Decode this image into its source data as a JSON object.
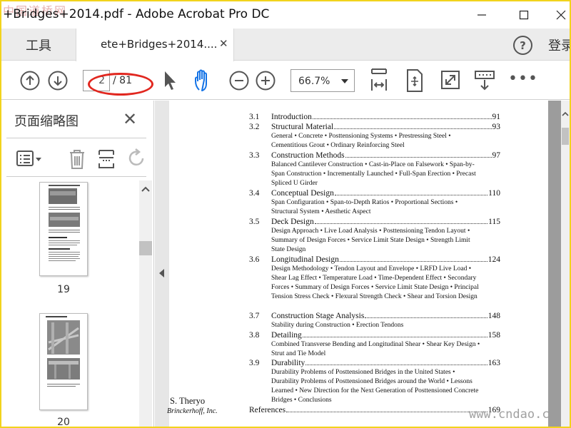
{
  "app": {
    "window_title": "+Bridges+2014.pdf - Adobe Acrobat Pro DC",
    "watermark_top": "中国道桥网",
    "watermark_bottom": "www.cndao.c"
  },
  "tabs": {
    "tools_label": "工具",
    "doc_label": "ete+Bridges+2014....",
    "signin_label": "登录"
  },
  "toolbar": {
    "current_page": "2",
    "total_pages": "/ 81",
    "zoom": "66.7%"
  },
  "sidebar": {
    "title": "页面缩略图",
    "thumbnails": [
      {
        "page_label": "19"
      },
      {
        "page_label": "20"
      }
    ]
  },
  "document": {
    "toc": [
      {
        "num": "3.1",
        "title": "Introduction",
        "page": "91",
        "subs": ""
      },
      {
        "num": "3.2",
        "title": "Structural Material",
        "page": "93",
        "subs": "General • Concrete • Posttensioning Systems • Prestressing Steel • Cementitious Grout • Ordinary Reinforcing Steel"
      },
      {
        "num": "3.3",
        "title": "Construction Methods",
        "page": "97",
        "subs": "Balanced Cantilever Construction • Cast-in-Place on Falsework • Span-by-Span Construction • Incrementally Launched • Full-Span Erection • Precast Spliced U Girder"
      },
      {
        "num": "3.4",
        "title": "Conceptual Design",
        "page": "110",
        "subs": "Span Configuration • Span-to-Depth Ratios • Proportional Sections • Structural System • Aesthetic Aspect"
      },
      {
        "num": "3.5",
        "title": "Deck Design",
        "page": "115",
        "subs": "Design Approach • Live Load Analysis • Posttensioning Tendon Layout • Summary of Design Forces • Service Limit State Design • Strength Limit State Design"
      },
      {
        "num": "3.6",
        "title": "Longitudinal Design",
        "page": "124",
        "subs": "Design Methodology • Tendon Layout and Envelope • LRFD Live Load • Shear Lag Effect • Temperature Load • Time-Dependent Effect • Secondary Forces • Summary of Design Forces • Service Limit State Design • Principal Tension Stress Check • Flexural Strength Check • Shear and Torsion Design"
      },
      {
        "num": "3.7",
        "title": "Construction Stage Analysis",
        "page": "148",
        "subs": "Stability during Construction • Erection Tendons"
      },
      {
        "num": "3.8",
        "title": "Detailing",
        "page": "158",
        "subs": "Combined Transverse Bending and Longitudinal Shear • Shear Key Design • Strut and Tie Model"
      },
      {
        "num": "3.9",
        "title": "Durability",
        "page": "163",
        "subs": "Durability Problems of Posttensioned Bridges in the United States • Durability Problems of Posttensioned Bridges around the World • Lessons Learned • New Direction for the Next Generation of Posttensioned Concrete Bridges • Conclusions"
      }
    ],
    "references_label": "References",
    "references_page": "169",
    "author_name": "S. Theryo",
    "author_affiliation": "Brinckerhoff, Inc."
  },
  "colors": {
    "highlight_ellipse": "#e1271f",
    "hand_tool_active": "#1473e6",
    "window_border": "#f2d31c"
  }
}
